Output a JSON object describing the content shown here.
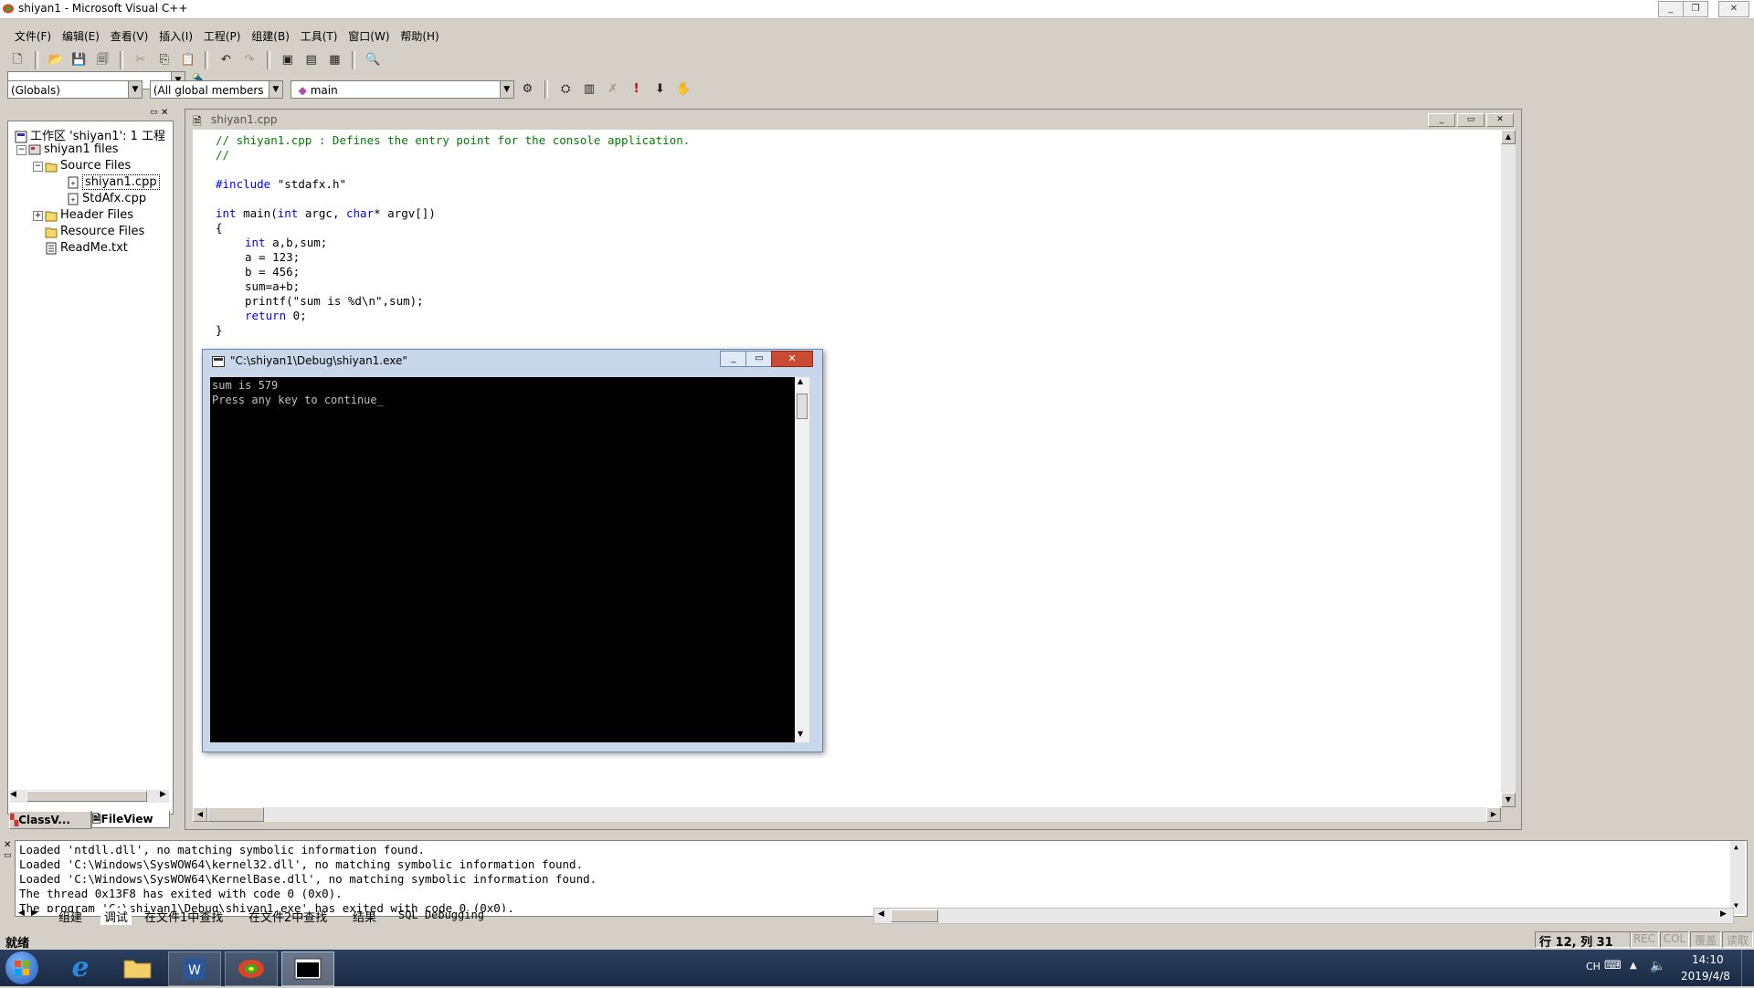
{
  "window": {
    "title": "shiyan1 - Microsoft Visual C++"
  },
  "menu": [
    "文件(F)",
    "编辑(E)",
    "查看(V)",
    "插入(I)",
    "工程(P)",
    "组建(B)",
    "工具(T)",
    "窗口(W)",
    "帮助(H)"
  ],
  "wizard_bar": {
    "scope": "(Globals)",
    "members": "(All global members",
    "function": "main"
  },
  "workspace": {
    "root": "工作区 'shiyan1': 1 工程",
    "project": "shiyan1 files",
    "source_folder": "Source Files",
    "source_files": [
      "shiyan1.cpp",
      "StdAfx.cpp"
    ],
    "header_folder": "Header Files",
    "resource_folder": "Resource Files",
    "readme": "ReadMe.txt",
    "tabs": [
      "ClassV...",
      "FileView"
    ]
  },
  "editor": {
    "title": "shiyan1.cpp",
    "lines": {
      "c1": "// shiyan1.cpp : Defines the entry point for the console application.",
      "c2": "//",
      "inc_kw": "#include",
      "inc_file": " \"stdafx.h\"",
      "main_int": "int",
      "main_mid1": " main(",
      "main_int2": "int",
      "main_mid2": " argc, ",
      "main_char": "char",
      "main_end": "* argv[])",
      "ob": "{",
      "decl_kw": "int",
      "decl_rest": " a,b,sum;",
      "l_a": "a = 123;",
      "l_b": "b = 456;",
      "l_sum": "sum=a+b;",
      "l_printf": "printf(\"sum is %d\\n\",sum);",
      "ret_kw": "return",
      "ret_rest": " 0;",
      "cb": "}"
    }
  },
  "console": {
    "title": "\"C:\\shiyan1\\Debug\\shiyan1.exe\"",
    "line1": "sum is 579",
    "line2": "Press any key to continue"
  },
  "output": {
    "lines": [
      "Loaded 'ntdll.dll', no matching symbolic information found.",
      "Loaded 'C:\\Windows\\SysWOW64\\kernel32.dll', no matching symbolic information found.",
      "Loaded 'C:\\Windows\\SysWOW64\\KernelBase.dll', no matching symbolic information found.",
      "The thread 0x13F8 has exited with code 0 (0x0).",
      "The program 'C:\\shiyan1\\Debug\\shiyan1.exe' has exited with code 0 (0x0)."
    ],
    "tabs": [
      "组建",
      "调试",
      "在文件1中查找",
      "在文件2中查找",
      "结果",
      "SQL Debugging"
    ]
  },
  "status": {
    "ready": "就绪",
    "position": "行 12, 列 31",
    "indicators": [
      "REC",
      "COL",
      "覆盖",
      "读取"
    ]
  },
  "taskbar": {
    "lang": "CH",
    "time": "14:10",
    "date": "2019/4/8"
  }
}
